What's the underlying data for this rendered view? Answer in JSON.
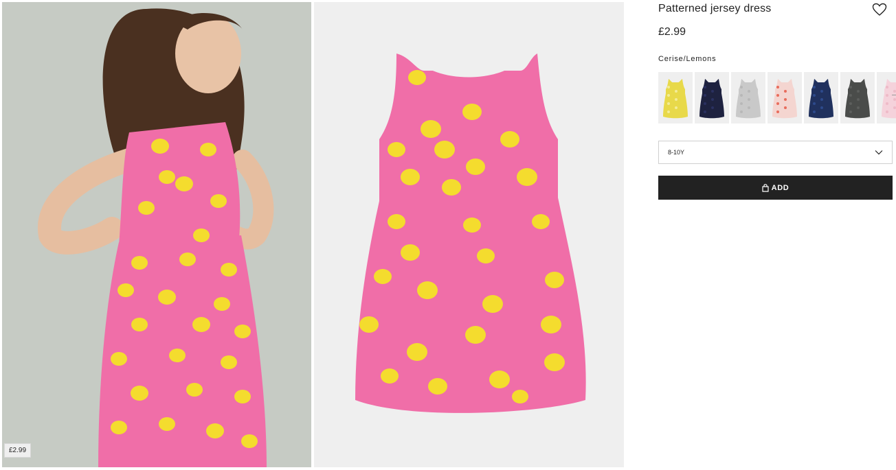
{
  "product": {
    "title": "Patterned jersey dress",
    "price": "£2.99",
    "image_price_tag": "£2.99",
    "color_name": "Cerise/Lemons",
    "size_selected": "8-10Y",
    "add_label": "ADD"
  },
  "swatches": [
    {
      "name": "yellow-pattern",
      "bg": "#e8d94a",
      "color": "#f3ec98"
    },
    {
      "name": "navy-pattern",
      "bg": "#1e2240",
      "color": "#2a3060"
    },
    {
      "name": "grey-pattern",
      "bg": "#c9c9c9",
      "color": "#b8b8b8"
    },
    {
      "name": "red-white-pattern",
      "bg": "#f4d5d0",
      "color": "#e86c5c"
    },
    {
      "name": "blue-pattern",
      "bg": "#20315e",
      "color": "#2d4a8c"
    },
    {
      "name": "dark-grey-pattern",
      "bg": "#4a4c4a",
      "color": "#5c5e5c"
    },
    {
      "name": "pink-pattern",
      "bg": "#f5d2db",
      "color": "#eebac8"
    }
  ],
  "colors": {
    "dress_pink": "#f06ea8",
    "lemon": "#f4dc2e",
    "button": "#222222"
  },
  "icons": [
    "heart-icon",
    "chevron-down-icon",
    "bag-icon"
  ]
}
